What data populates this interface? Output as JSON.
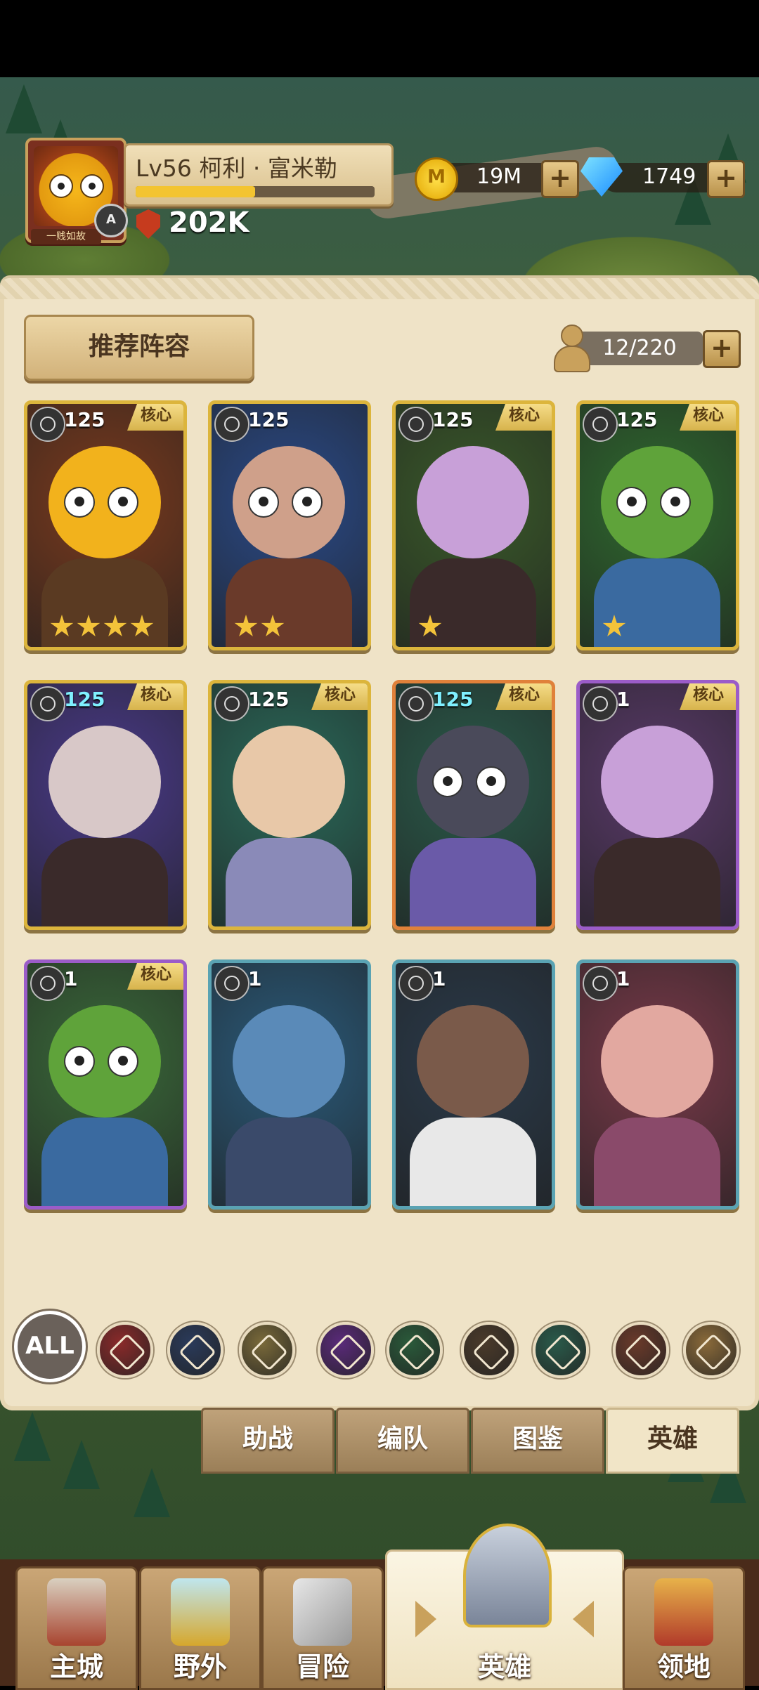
{
  "player": {
    "level_text": "Lv56",
    "name": "柯利 · 富米勒",
    "avatar_badge": "一贱如故",
    "power": "202K",
    "xp_progress": 0.5
  },
  "currency": {
    "gold": "19M",
    "gems": "1749",
    "gold_icon_letter": "M",
    "plus": "+"
  },
  "panel": {
    "recommend_label": "推荐阵容",
    "capacity": "12/220"
  },
  "heroes": [
    {
      "level": "125",
      "core": "核心",
      "stars": 4
    },
    {
      "level": "125",
      "core": "",
      "stars": 2
    },
    {
      "level": "125",
      "core": "核心",
      "stars": 1
    },
    {
      "level": "125",
      "core": "核心",
      "stars": 1
    },
    {
      "level": "125",
      "core": "核心",
      "stars": 0
    },
    {
      "level": "125",
      "core": "核心",
      "stars": 0
    },
    {
      "level": "125",
      "core": "核心",
      "stars": 0
    },
    {
      "level": "1",
      "core": "核心",
      "stars": 0
    },
    {
      "level": "1",
      "core": "核心",
      "stars": 0
    },
    {
      "level": "1",
      "core": "",
      "stars": 0
    },
    {
      "level": "1",
      "core": "",
      "stars": 0
    },
    {
      "level": "1",
      "core": "",
      "stars": 0
    }
  ],
  "filters": {
    "all_label": "ALL",
    "icons": [
      "shield-icon",
      "staff-icon",
      "wings-icon",
      "skull-icon",
      "crossed-swords-icon",
      "paw-icon",
      "bow-icon",
      "bull-icon",
      "hammer-icon"
    ]
  },
  "tabs": [
    "助战",
    "编队",
    "图鉴",
    "英雄"
  ],
  "nav": [
    "主城",
    "野外",
    "冒险",
    "英雄",
    "领地"
  ]
}
